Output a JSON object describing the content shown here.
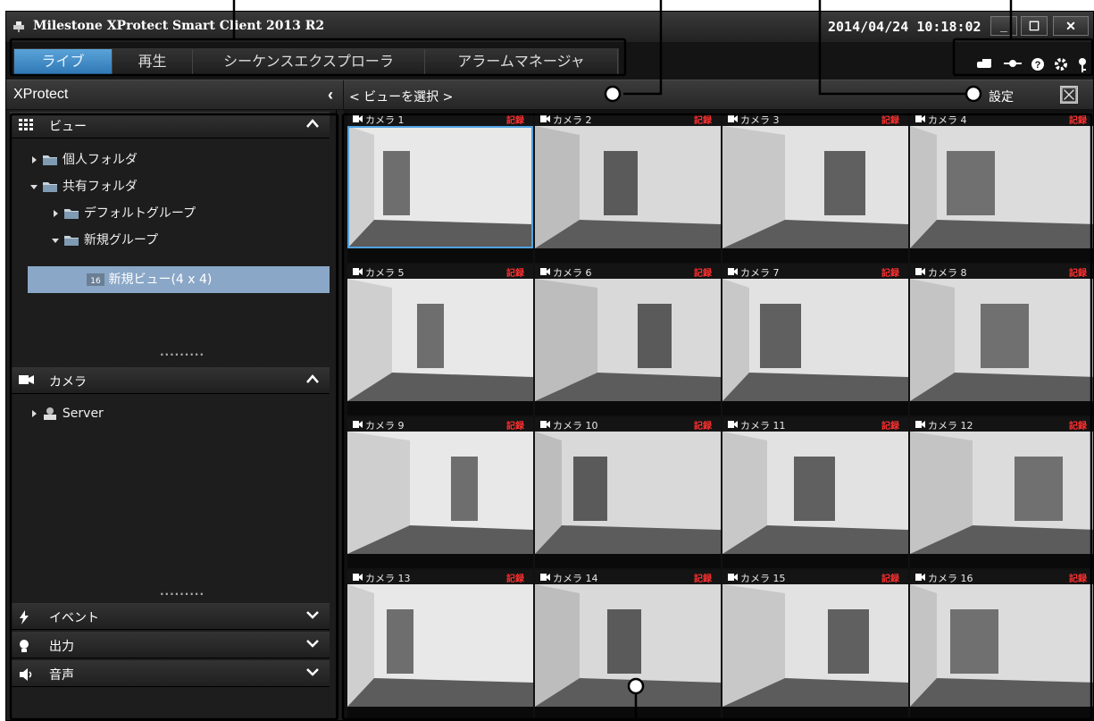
{
  "window": {
    "title": "Milestone XProtect Smart Client 2013 R2",
    "datetime": "2014/04/24 10:18:02",
    "minimize": "_",
    "maximize": "☐",
    "close": "✕"
  },
  "tabs": [
    {
      "label": "ライブ",
      "active": true
    },
    {
      "label": "再生",
      "active": false
    },
    {
      "label": "シーケンスエクスプローラ",
      "active": false
    },
    {
      "label": "アラームマネージャ",
      "active": false
    }
  ],
  "toolbar_icons": [
    "status-icon",
    "connection-icon",
    "help-icon",
    "settings-gear-icon",
    "logout-key-icon"
  ],
  "header": {
    "brand": "XProtect",
    "collapse": "‹",
    "view_selector": "< ビューを選択 >",
    "settings": "設定"
  },
  "sidebar": {
    "views_title": "ビュー",
    "tree": [
      {
        "label": "個人フォルダ",
        "level": 1,
        "expanded": false
      },
      {
        "label": "共有フォルダ",
        "level": 1,
        "expanded": true
      },
      {
        "label": "デフォルトグループ",
        "level": 2,
        "expanded": false
      },
      {
        "label": "新規グループ",
        "level": 2,
        "expanded": true
      },
      {
        "label": "新規ビュー(4 x 4)",
        "level": 3,
        "badge": "16",
        "selected": true
      }
    ],
    "dots": ".........",
    "cameras_title": "カメラ",
    "server": "Server",
    "events_title": "イベント",
    "output_title": "出力",
    "audio_title": "音声"
  },
  "grid": {
    "rec_label": "記録",
    "cameras": [
      {
        "name": "カメラ 1",
        "scene": "door-left"
      },
      {
        "name": "カメラ 2",
        "scene": "corridor"
      },
      {
        "name": "カメラ 3",
        "scene": "door-center"
      },
      {
        "name": "カメラ 4",
        "scene": "room-corner"
      },
      {
        "name": "カメラ 5",
        "scene": "wall-door"
      },
      {
        "name": "カメラ 6",
        "scene": "elevator"
      },
      {
        "name": "カメラ 7",
        "scene": "stairs"
      },
      {
        "name": "カメラ 8",
        "scene": "table-room"
      },
      {
        "name": "カメラ 9",
        "scene": "meeting-room"
      },
      {
        "name": "カメラ 10",
        "scene": "large-room"
      },
      {
        "name": "カメラ 11",
        "scene": "window-room"
      },
      {
        "name": "カメラ 12",
        "scene": "entrance"
      },
      {
        "name": "カメラ 13",
        "scene": "corner"
      },
      {
        "name": "カメラ 14",
        "scene": "elevator-2"
      },
      {
        "name": "カメラ 15",
        "scene": "double-door"
      },
      {
        "name": "カメラ 16",
        "scene": "door-right"
      }
    ]
  }
}
